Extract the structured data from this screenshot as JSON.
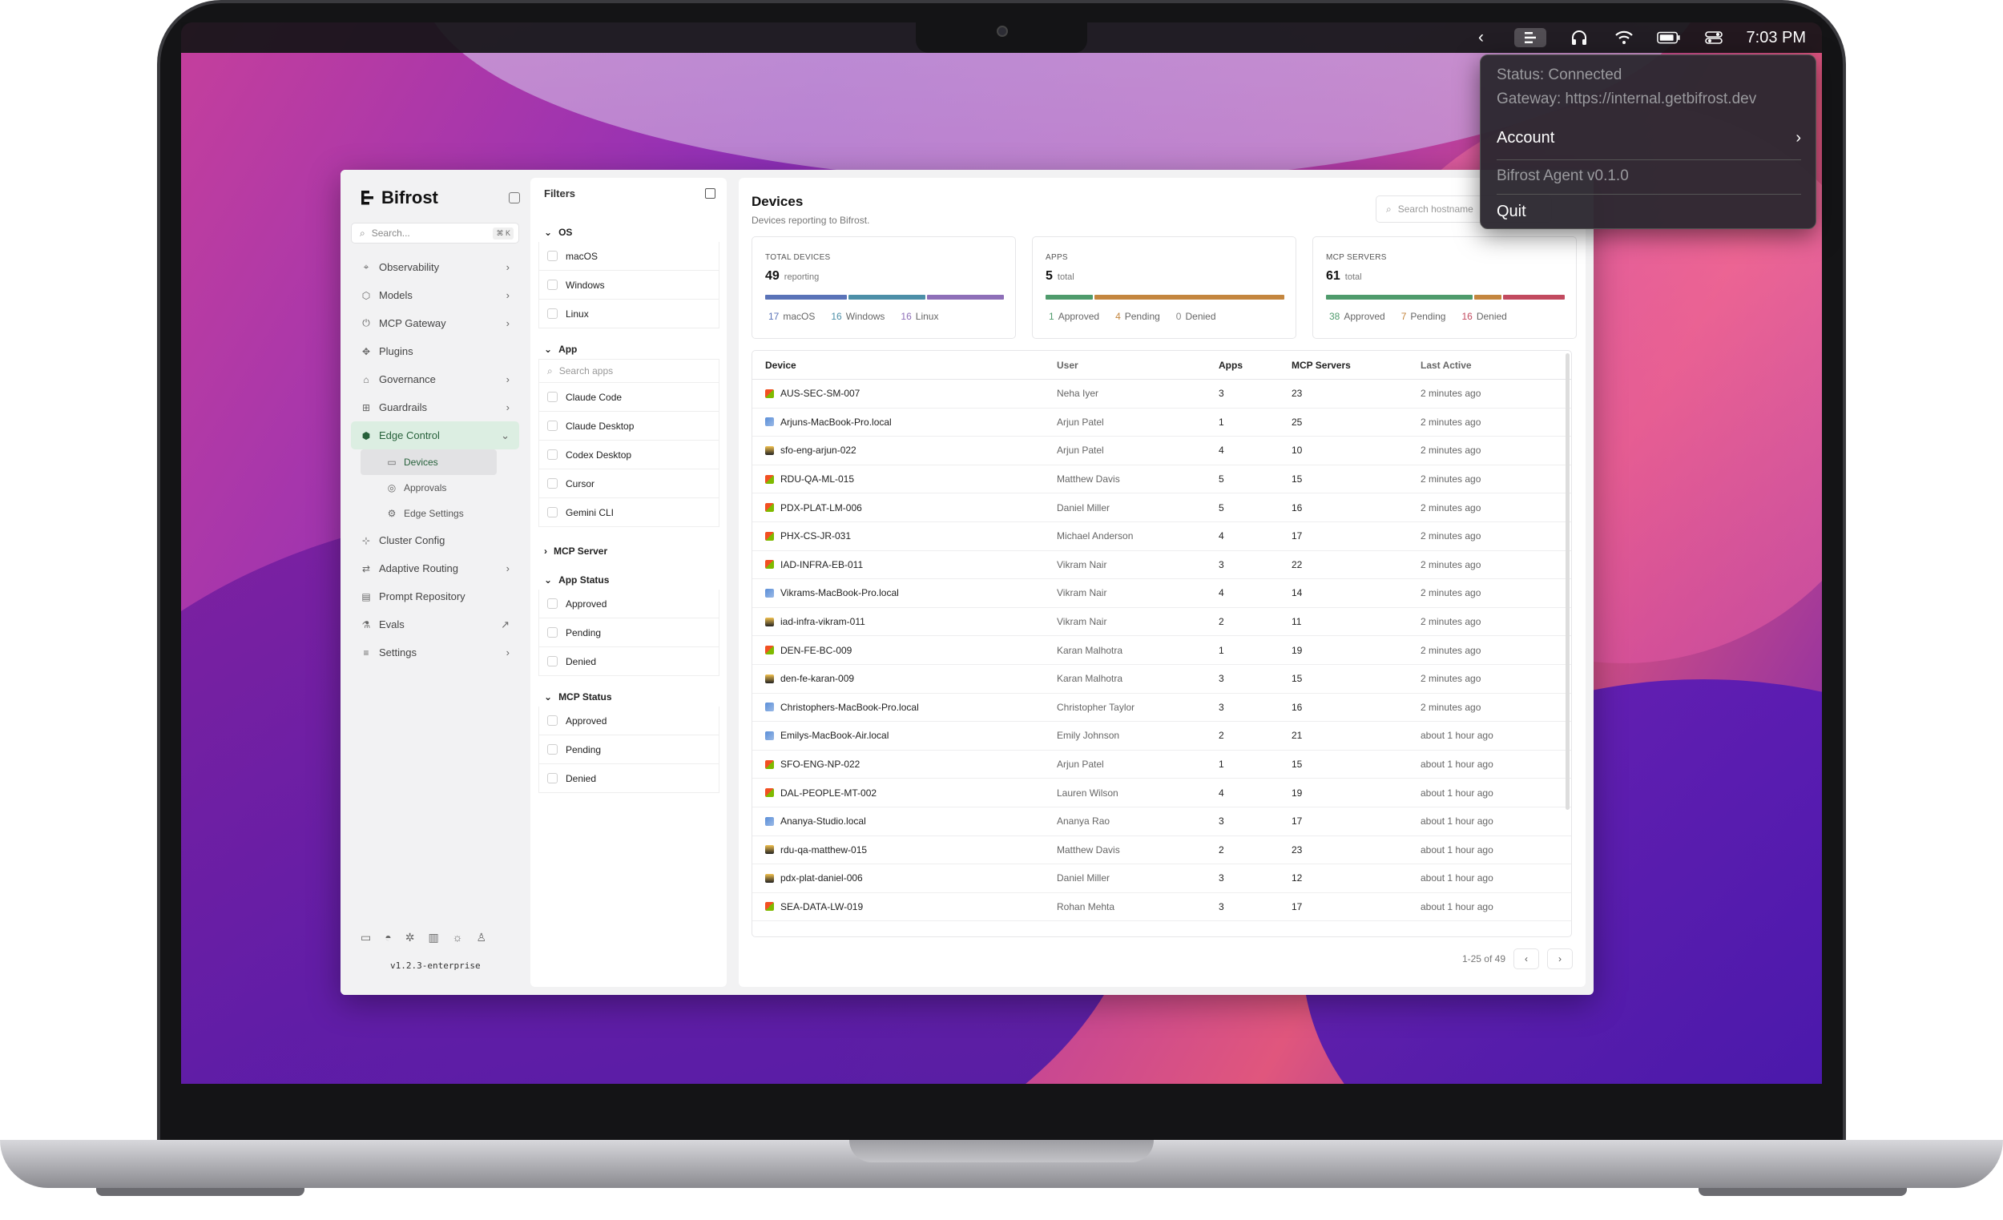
{
  "menubar": {
    "time": "7:03 PM"
  },
  "dropdown": {
    "status": "Status: Connected",
    "gateway": "Gateway: https://internal.getbifrost.dev",
    "account": "Account",
    "version": "Bifrost Agent v0.1.0",
    "quit": "Quit"
  },
  "sidebar": {
    "brand": "Bifrost",
    "search_placeholder": "Search...",
    "shortcut": "⌘ K",
    "items": [
      {
        "label": "Observability",
        "icon": "telescope-icon",
        "chevron": "›"
      },
      {
        "label": "Models",
        "icon": "cube-icon",
        "chevron": "›"
      },
      {
        "label": "MCP Gateway",
        "icon": "plug-icon",
        "chevron": "›"
      },
      {
        "label": "Plugins",
        "icon": "puzzle-icon",
        "chevron": ""
      },
      {
        "label": "Governance",
        "icon": "bank-icon",
        "chevron": "›"
      },
      {
        "label": "Guardrails",
        "icon": "guardrail-icon",
        "chevron": "›"
      },
      {
        "label": "Edge Control",
        "icon": "hexagon-icon",
        "chevron": "⌄"
      }
    ],
    "subitems": [
      {
        "label": "Devices",
        "icon": "monitor-icon"
      },
      {
        "label": "Approvals",
        "icon": "check-circle-icon"
      },
      {
        "label": "Edge Settings",
        "icon": "gear-icon"
      }
    ],
    "items2": [
      {
        "label": "Cluster Config",
        "icon": "cluster-icon",
        "chevron": ""
      },
      {
        "label": "Adaptive Routing",
        "icon": "shuffle-icon",
        "chevron": "›"
      },
      {
        "label": "Prompt Repository",
        "icon": "folder-icon",
        "chevron": ""
      },
      {
        "label": "Evals",
        "icon": "flask-icon",
        "chevron": "↗"
      },
      {
        "label": "Settings",
        "icon": "sliders-icon",
        "chevron": "›"
      }
    ],
    "version": "v1.2.3-enterprise"
  },
  "filters": {
    "title": "Filters",
    "os": {
      "label": "OS",
      "options": [
        "macOS",
        "Windows",
        "Linux"
      ]
    },
    "app": {
      "label": "App",
      "search_placeholder": "Search apps",
      "options": [
        "Claude Code",
        "Claude Desktop",
        "Codex Desktop",
        "Cursor",
        "Gemini CLI"
      ]
    },
    "mcp_server": {
      "label": "MCP Server"
    },
    "app_status": {
      "label": "App Status",
      "options": [
        "Approved",
        "Pending",
        "Denied"
      ]
    },
    "mcp_status": {
      "label": "MCP Status",
      "options": [
        "Approved",
        "Pending",
        "Denied"
      ]
    }
  },
  "main": {
    "title": "Devices",
    "subtitle": "Devices reporting to Bifrost.",
    "search_placeholder": "Search hostname",
    "cards": [
      {
        "label": "TOTAL DEVICES",
        "value": "49",
        "unit": "reporting",
        "legend": [
          {
            "count": "17",
            "label": "macOS",
            "color": "#5a73b8"
          },
          {
            "count": "16",
            "label": "Windows",
            "color": "#4c8fa8"
          },
          {
            "count": "16",
            "label": "Linux",
            "color": "#8e6fb8"
          }
        ],
        "segments": [
          {
            "value": 17,
            "color": "#5a73b8"
          },
          {
            "value": 16,
            "color": "#4c8fa8"
          },
          {
            "value": 16,
            "color": "#8e6fb8"
          }
        ]
      },
      {
        "label": "APPS",
        "value": "5",
        "unit": "total",
        "legend": [
          {
            "count": "1",
            "label": "Approved",
            "color": "#4f9b6c"
          },
          {
            "count": "4",
            "label": "Pending",
            "color": "#c4863f"
          },
          {
            "count": "0",
            "label": "Denied",
            "color": "#888888"
          }
        ],
        "segments": [
          {
            "value": 1,
            "color": "#4f9b6c"
          },
          {
            "value": 4,
            "color": "#c4863f"
          }
        ]
      },
      {
        "label": "MCP SERVERS",
        "value": "61",
        "unit": "total",
        "legend": [
          {
            "count": "38",
            "label": "Approved",
            "color": "#4f9b6c"
          },
          {
            "count": "7",
            "label": "Pending",
            "color": "#c4863f"
          },
          {
            "count": "16",
            "label": "Denied",
            "color": "#c24a5f"
          }
        ],
        "segments": [
          {
            "value": 38,
            "color": "#4f9b6c"
          },
          {
            "value": 7,
            "color": "#c4863f"
          },
          {
            "value": 16,
            "color": "#c24a5f"
          }
        ]
      }
    ],
    "columns": [
      "Device",
      "User",
      "Apps",
      "MCP Servers",
      "Last Active"
    ],
    "rows": [
      {
        "device": "AUS-SEC-SM-007",
        "os": "windows",
        "user": "Neha Iyer",
        "apps": "3",
        "mcp": "23",
        "last": "2 minutes ago"
      },
      {
        "device": "Arjuns-MacBook-Pro.local",
        "os": "macos",
        "user": "Arjun Patel",
        "apps": "1",
        "mcp": "25",
        "last": "2 minutes ago"
      },
      {
        "device": "sfo-eng-arjun-022",
        "os": "linux",
        "user": "Arjun Patel",
        "apps": "4",
        "mcp": "10",
        "last": "2 minutes ago"
      },
      {
        "device": "RDU-QA-ML-015",
        "os": "windows",
        "user": "Matthew Davis",
        "apps": "5",
        "mcp": "15",
        "last": "2 minutes ago"
      },
      {
        "device": "PDX-PLAT-LM-006",
        "os": "windows",
        "user": "Daniel Miller",
        "apps": "5",
        "mcp": "16",
        "last": "2 minutes ago"
      },
      {
        "device": "PHX-CS-JR-031",
        "os": "windows",
        "user": "Michael Anderson",
        "apps": "4",
        "mcp": "17",
        "last": "2 minutes ago"
      },
      {
        "device": "IAD-INFRA-EB-011",
        "os": "windows",
        "user": "Vikram Nair",
        "apps": "3",
        "mcp": "22",
        "last": "2 minutes ago"
      },
      {
        "device": "Vikrams-MacBook-Pro.local",
        "os": "macos",
        "user": "Vikram Nair",
        "apps": "4",
        "mcp": "14",
        "last": "2 minutes ago"
      },
      {
        "device": "iad-infra-vikram-011",
        "os": "linux",
        "user": "Vikram Nair",
        "apps": "2",
        "mcp": "11",
        "last": "2 minutes ago"
      },
      {
        "device": "DEN-FE-BC-009",
        "os": "windows",
        "user": "Karan Malhotra",
        "apps": "1",
        "mcp": "19",
        "last": "2 minutes ago"
      },
      {
        "device": "den-fe-karan-009",
        "os": "linux",
        "user": "Karan Malhotra",
        "apps": "3",
        "mcp": "15",
        "last": "2 minutes ago"
      },
      {
        "device": "Christophers-MacBook-Pro.local",
        "os": "macos",
        "user": "Christopher Taylor",
        "apps": "3",
        "mcp": "16",
        "last": "2 minutes ago"
      },
      {
        "device": "Emilys-MacBook-Air.local",
        "os": "macos",
        "user": "Emily Johnson",
        "apps": "2",
        "mcp": "21",
        "last": "about 1 hour ago"
      },
      {
        "device": "SFO-ENG-NP-022",
        "os": "windows",
        "user": "Arjun Patel",
        "apps": "1",
        "mcp": "15",
        "last": "about 1 hour ago"
      },
      {
        "device": "DAL-PEOPLE-MT-002",
        "os": "windows",
        "user": "Lauren Wilson",
        "apps": "4",
        "mcp": "19",
        "last": "about 1 hour ago"
      },
      {
        "device": "Ananya-Studio.local",
        "os": "macos",
        "user": "Ananya Rao",
        "apps": "3",
        "mcp": "17",
        "last": "about 1 hour ago"
      },
      {
        "device": "rdu-qa-matthew-015",
        "os": "linux",
        "user": "Matthew Davis",
        "apps": "2",
        "mcp": "23",
        "last": "about 1 hour ago"
      },
      {
        "device": "pdx-plat-daniel-006",
        "os": "linux",
        "user": "Daniel Miller",
        "apps": "3",
        "mcp": "12",
        "last": "about 1 hour ago"
      },
      {
        "device": "SEA-DATA-LW-019",
        "os": "windows",
        "user": "Rohan Mehta",
        "apps": "3",
        "mcp": "17",
        "last": "about 1 hour ago"
      }
    ],
    "pagination": "1-25 of 49",
    "prev": "‹",
    "next": "›"
  }
}
